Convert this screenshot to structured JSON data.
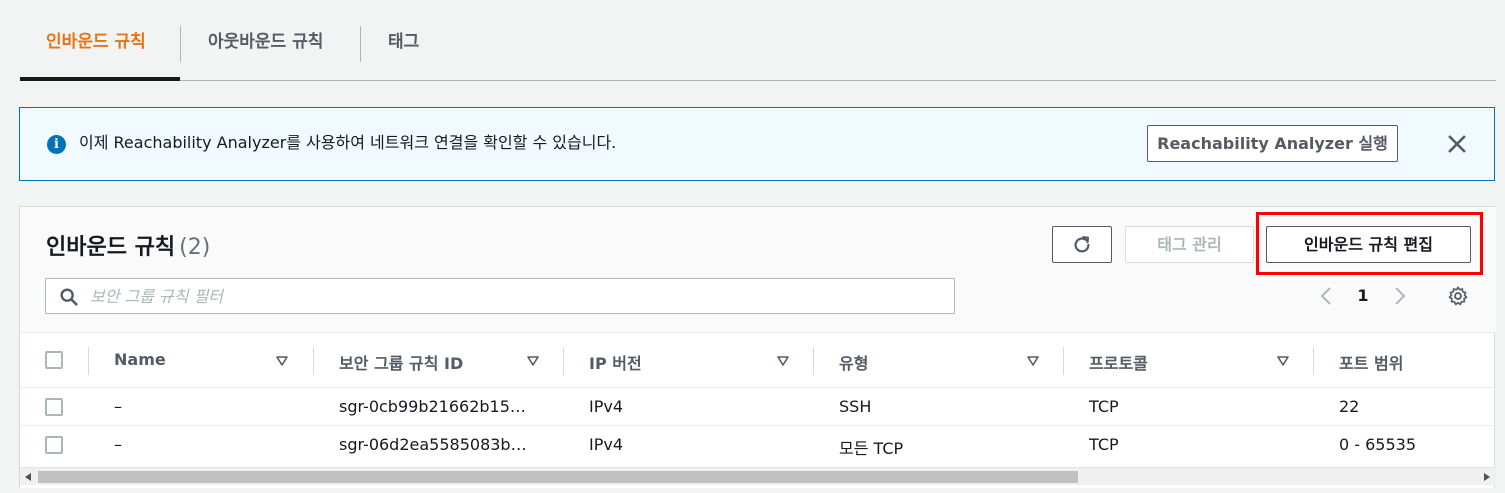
{
  "tabs": [
    {
      "label": "인바운드 규칙",
      "active": true
    },
    {
      "label": "아웃바운드 규칙",
      "active": false
    },
    {
      "label": "태그",
      "active": false
    }
  ],
  "alert": {
    "icon": "info-icon",
    "icon_glyph": "i",
    "text": "이제 Reachability Analyzer를 사용하여 네트워크 연결을 확인할 수 있습니다.",
    "button_label": "Reachability Analyzer 실행",
    "close_icon": "close-icon"
  },
  "panel": {
    "title": "인바운드 규칙",
    "count": "(2)",
    "refresh_icon": "refresh-icon",
    "manage_tags_label": "태그 관리",
    "edit_rules_label": "인바운드 규칙 편집",
    "search_placeholder": "보안 그룹 규칙 필터",
    "page_number": "1"
  },
  "table": {
    "columns": [
      "Name",
      "보안 그룹 규칙 ID",
      "IP 버전",
      "유형",
      "프로토콜",
      "포트 범위"
    ],
    "rows": [
      {
        "name": "–",
        "rule_id": "sgr-0cb99b21662b15…",
        "ip_version": "IPv4",
        "type": "SSH",
        "protocol": "TCP",
        "port_range": "22"
      },
      {
        "name": "–",
        "rule_id": "sgr-06d2ea5585083b…",
        "ip_version": "IPv4",
        "type": "모든 TCP",
        "protocol": "TCP",
        "port_range": "0 - 65535"
      }
    ]
  },
  "colors": {
    "accent": "#ec7211",
    "info": "#0073bb",
    "highlight": "#ff0000"
  }
}
